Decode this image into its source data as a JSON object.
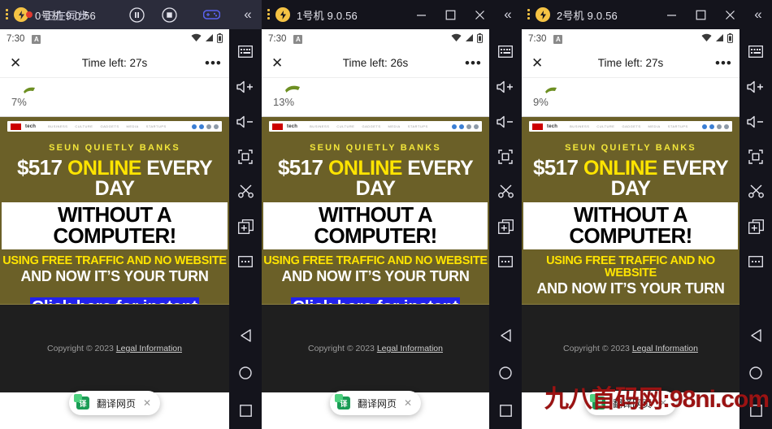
{
  "colors": {
    "titlebar_active": "#2b2c3b",
    "titlebar_dark": "#14141c",
    "sidebar": "#14141c",
    "ad_background": "#6b6028",
    "ad_yellow": "#ffe400",
    "ad_link_blue": "#2222ee",
    "accent_gamepad": "#5b63f0",
    "logo_yellow": "#f5c344",
    "watermark_red": "#9b1313"
  },
  "windows": [
    {
      "title": "0号机 9.0.56",
      "title_ghost": "正在同步",
      "title_style": "active",
      "controls": [
        "pause",
        "stop",
        "gamepad",
        "collapse"
      ],
      "status": {
        "time": "7:30",
        "badge": "A",
        "icons": [
          "wifi-icon",
          "signal-icon",
          "battery-icon"
        ]
      },
      "adbar": {
        "close": "✕",
        "title": "Time left: 27s",
        "more": "•••"
      },
      "progress": {
        "percent": "7%"
      },
      "toast": {
        "label": "翻译网页",
        "close": "✕"
      }
    },
    {
      "title": "1号机 9.0.56",
      "title_ghost": "",
      "title_style": "dark",
      "controls": [
        "minimize",
        "maximize",
        "close",
        "collapse"
      ],
      "status": {
        "time": "7:30",
        "badge": "A",
        "icons": [
          "wifi-icon",
          "signal-icon",
          "battery-icon"
        ]
      },
      "adbar": {
        "close": "✕",
        "title": "Time left: 26s",
        "more": "•••"
      },
      "progress": {
        "percent": "13%"
      },
      "toast": {
        "label": "翻译网页",
        "close": "✕"
      }
    },
    {
      "title": "2号机 9.0.56",
      "title_ghost": "",
      "title_style": "dark",
      "controls": [
        "minimize",
        "maximize",
        "close",
        "collapse"
      ],
      "status": {
        "time": "7:30",
        "badge": "A",
        "icons": [
          "wifi-icon",
          "signal-icon",
          "battery-icon"
        ]
      },
      "adbar": {
        "close": "✕",
        "title": "Time left: 27s",
        "more": "•••"
      },
      "progress": {
        "percent": "9%"
      },
      "toast": {
        "label": "翻译网页",
        "close": "✕"
      }
    }
  ],
  "ad": {
    "fakebar": {
      "brand": "CNN",
      "section": "tech",
      "nav": [
        "BUSINESS",
        "CULTURE",
        "GADGETS",
        "MEDIA",
        "STARTUPS"
      ]
    },
    "kicker": "SEUN QUIETLY BANKS",
    "headline_1_a": "$517 ",
    "headline_1_b": "ONLINE",
    "headline_1_c": " EVERY DAY",
    "headline_2": "WITHOUT A COMPUTER!",
    "sub_1": "USING FREE TRAFFIC AND NO WEBSITE",
    "sub_2": "AND NOW IT’S YOUR TURN",
    "cta": "Click here for instant access",
    "footer_text": "Copyright © 2023 ",
    "footer_link": "Legal Information"
  },
  "sidebar": {
    "items": [
      {
        "name": "keyboard-icon",
        "label": "键盘"
      },
      {
        "name": "volume-up-icon",
        "label": "音量+"
      },
      {
        "name": "volume-down-icon",
        "label": "音量-"
      },
      {
        "name": "fullscreen-icon",
        "label": "全屏"
      },
      {
        "name": "shake-icon",
        "label": "摇一摇"
      },
      {
        "name": "add-window-icon",
        "label": "添加"
      },
      {
        "name": "more-icon",
        "label": "更多"
      }
    ],
    "nav": [
      {
        "name": "back-button",
        "label": "返回"
      },
      {
        "name": "home-button",
        "label": "主页"
      },
      {
        "name": "recents-button",
        "label": "任务"
      }
    ]
  },
  "watermark": "九八首码网:98ni.com"
}
